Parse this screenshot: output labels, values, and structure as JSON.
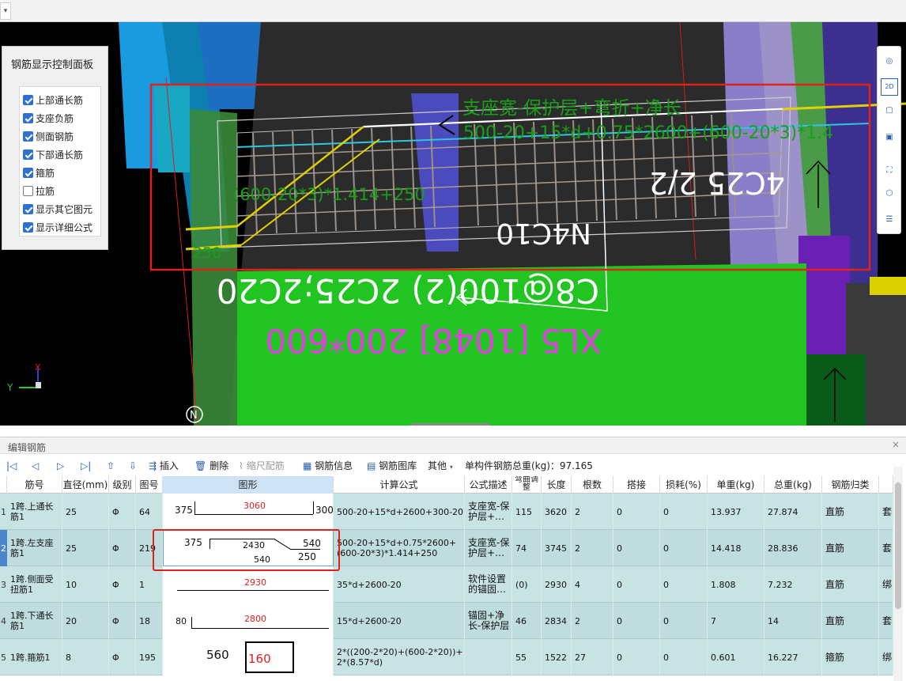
{
  "control_panel": {
    "title": "钢筋显示控制面板",
    "items": [
      {
        "label": "上部通长筋",
        "checked": true
      },
      {
        "label": "支座负筋",
        "checked": true
      },
      {
        "label": "侧面钢筋",
        "checked": true
      },
      {
        "label": "下部通长筋",
        "checked": true
      },
      {
        "label": "箍筋",
        "checked": true
      },
      {
        "label": "拉筋",
        "checked": false
      },
      {
        "label": "显示其它图元",
        "checked": true
      },
      {
        "label": "显示详细公式",
        "checked": true
      }
    ]
  },
  "viewport": {
    "annotations": {
      "top_formula_label": "支座宽-保护层+弯折+净长",
      "top_formula": "500-20+15*d+0.75*2600+(600-20*3)*1.4",
      "left_formula": "(600-20*3)*1.414+250",
      "label_250": "250",
      "rebar_4c25": "4C25 2/2",
      "rebar_n4c10": "N4C10",
      "stirrup": "C8@100(2) 2C25;2C20",
      "beam_name": "XL5 [1048] 200*600"
    },
    "axis": {
      "y": "Y",
      "compass": "N"
    },
    "tools": [
      "sphere-view-icon",
      "2d-icon",
      "cube-icon",
      "box-icon",
      "fullscreen-icon",
      "cube-select-icon",
      "list-view-icon"
    ],
    "tool_2d_label": "2D"
  },
  "edit_panel": {
    "title": "编辑钢筋",
    "close": "×",
    "toolbar": {
      "insert": "插入",
      "delete": "删除",
      "scale": "缩尺配筋",
      "info": "钢筋信息",
      "library": "钢筋图库",
      "other": "其他",
      "total": "单构件钢筋总重(kg)：97.165"
    },
    "columns": [
      "筋号",
      "直径(mm)",
      "级别",
      "图号",
      "图形",
      "计算公式",
      "公式描述",
      "弯曲调整",
      "长度",
      "根数",
      "搭接",
      "损耗(%)",
      "单重(kg)",
      "总重(kg)",
      "钢筋归类",
      ""
    ],
    "rows": [
      {
        "num": "1",
        "name": "1跨.上通长筋1",
        "dia": "25",
        "grade": "Φ",
        "fig": "64",
        "shape": {
          "left": "375",
          "mid": "3060",
          "right": "300"
        },
        "formula": "500-20+15*d+2600+300-20",
        "desc": "支座宽-保护层+…",
        "bend": "115",
        "len": "3620",
        "count": "2",
        "lap": "0",
        "loss": "0",
        "unit": "13.937",
        "total": "27.874",
        "cls": "直筋",
        "extra": "套"
      },
      {
        "num": "2",
        "name": "1跨.左支座筋1",
        "dia": "25",
        "grade": "Φ",
        "fig": "219",
        "shape": {
          "a": "375",
          "b": "2430",
          "c": "540",
          "d": "540",
          "e": "250"
        },
        "formula": "500-20+15*d+0.75*2600+(600-20*3)*1.414+250",
        "desc": "支座宽-保护层+…",
        "bend": "74",
        "len": "3745",
        "count": "2",
        "lap": "0",
        "loss": "0",
        "unit": "14.418",
        "total": "28.836",
        "cls": "直筋",
        "extra": "套"
      },
      {
        "num": "3",
        "name": "1跨.侧面受扭筋1",
        "dia": "10",
        "grade": "Φ",
        "fig": "1",
        "shape": {
          "mid": "2930"
        },
        "formula": "35*d+2600-20",
        "desc": "软件设置的锚固…",
        "bend": "(0)",
        "len": "2930",
        "count": "4",
        "lap": "0",
        "loss": "0",
        "unit": "1.808",
        "total": "7.232",
        "cls": "直筋",
        "extra": "绑"
      },
      {
        "num": "4",
        "name": "1跨.下通长筋1",
        "dia": "20",
        "grade": "Φ",
        "fig": "18",
        "shape": {
          "left": "80",
          "mid": "2800"
        },
        "formula": "15*d+2600-20",
        "desc": "锚固+净长-保护层",
        "bend": "46",
        "len": "2834",
        "count": "2",
        "lap": "0",
        "loss": "0",
        "unit": "7",
        "total": "14",
        "cls": "直筋",
        "extra": "套"
      },
      {
        "num": "5",
        "name": "1跨.箍筋1",
        "dia": "8",
        "grade": "Φ",
        "fig": "195",
        "shape": {
          "left": "560",
          "mid": "160"
        },
        "formula": "2*((200-2*20)+(600-2*20))+2*(8.57*d)",
        "desc": "",
        "bend": "55",
        "len": "1522",
        "count": "27",
        "lap": "0",
        "loss": "0",
        "unit": "0.601",
        "total": "16.227",
        "cls": "箍筋",
        "extra": "绑"
      }
    ]
  }
}
